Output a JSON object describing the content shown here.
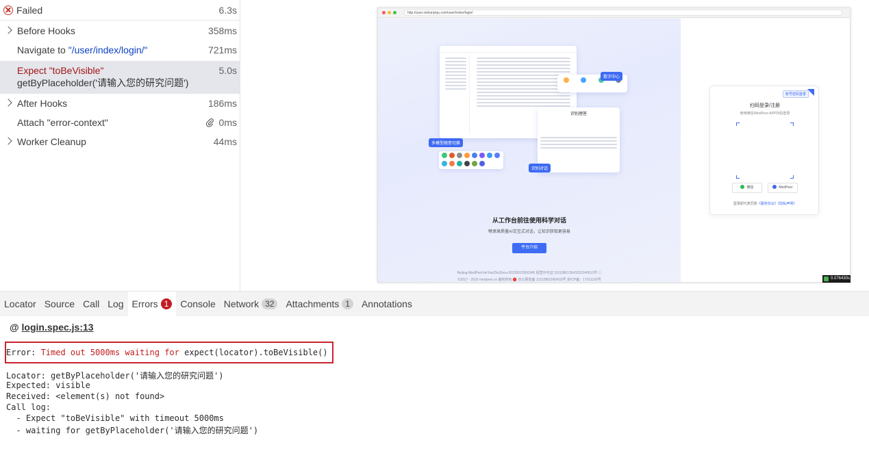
{
  "actions": {
    "header": {
      "label": "Failed",
      "duration": "6.3s"
    },
    "rows": [
      {
        "title": "Before Hooks",
        "duration": "358ms"
      },
      {
        "title_prefix": "Navigate to ",
        "title_url": "\"/user/index/login/\"",
        "duration": "721ms"
      },
      {
        "title": "Expect \"toBeVisible\"",
        "subtitle": "getByPlaceholder('请输入您的研究问题')",
        "duration": "5.0s"
      },
      {
        "title": "After Hooks",
        "duration": "186ms"
      },
      {
        "title": "Attach \"error-context\"",
        "duration": "0ms"
      },
      {
        "title": "Worker Cleanup",
        "duration": "44ms"
      }
    ]
  },
  "screenshot": {
    "url": "http://user.xishanyiqu.com/user/index/login/",
    "tags": {
      "data_center": "数字中心",
      "multi_model": "多模型随意切换",
      "knowledge": "识别对话",
      "knowledge_card": "识别理答"
    },
    "hero_title": "从工作台前往使用科学对话",
    "hero_sub": "畅享高质量AI交互式对话，让知识获取更容易",
    "hero_button": "平台介绍",
    "footer1": "Beijing-MedPeerVerYanZhuShou-20220012500345   经营许可证 110108013543201240913号  ⓘ",
    "footer2": "©2017 - 2025 medpeer.cn 版权所有   🔴 京公网安备 11010802000433号   京ICP备：17011190号",
    "login": {
      "password_tag": "账号密码登录",
      "title": "扫码登录/注册",
      "subtitle": "使用微信/MedPeer APP扫码登录",
      "wechat": "微信",
      "medpeer": "MedPeer",
      "agree_prefix": "登录即代表同意",
      "agree_terms": "《服务协议》",
      "agree_privacy": "《隐私声明》"
    },
    "badge": "0.076430s"
  },
  "tabs": [
    {
      "label": "Locator"
    },
    {
      "label": "Source"
    },
    {
      "label": "Call"
    },
    {
      "label": "Log"
    },
    {
      "label": "Errors",
      "count": "1"
    },
    {
      "label": "Console"
    },
    {
      "label": "Network",
      "count": "32"
    },
    {
      "label": "Attachments",
      "count": "1"
    },
    {
      "label": "Annotations"
    }
  ],
  "errors": {
    "spec_prefix": "@ ",
    "spec_link": "login.spec.js:13",
    "error_label": "Error: ",
    "error_message": "Timed out 5000ms waiting for ",
    "error_expect": "expect(locator).toBeVisible()",
    "locator": "Locator: getByPlaceholder('请输入您的研究问题')",
    "expected": "Expected: visible",
    "received": "Received: <element(s) not found>",
    "call_log": "Call log:",
    "log1": "  - Expect \"toBeVisible\" with timeout 5000ms",
    "log2": "  - waiting for getByPlaceholder('请输入您的研究问题')"
  },
  "colors": {
    "error_red": "#c8232b",
    "selected_bg": "#e4e6ec",
    "link_blue": "#0b3fc2",
    "accent_blue": "#3d6af2"
  }
}
